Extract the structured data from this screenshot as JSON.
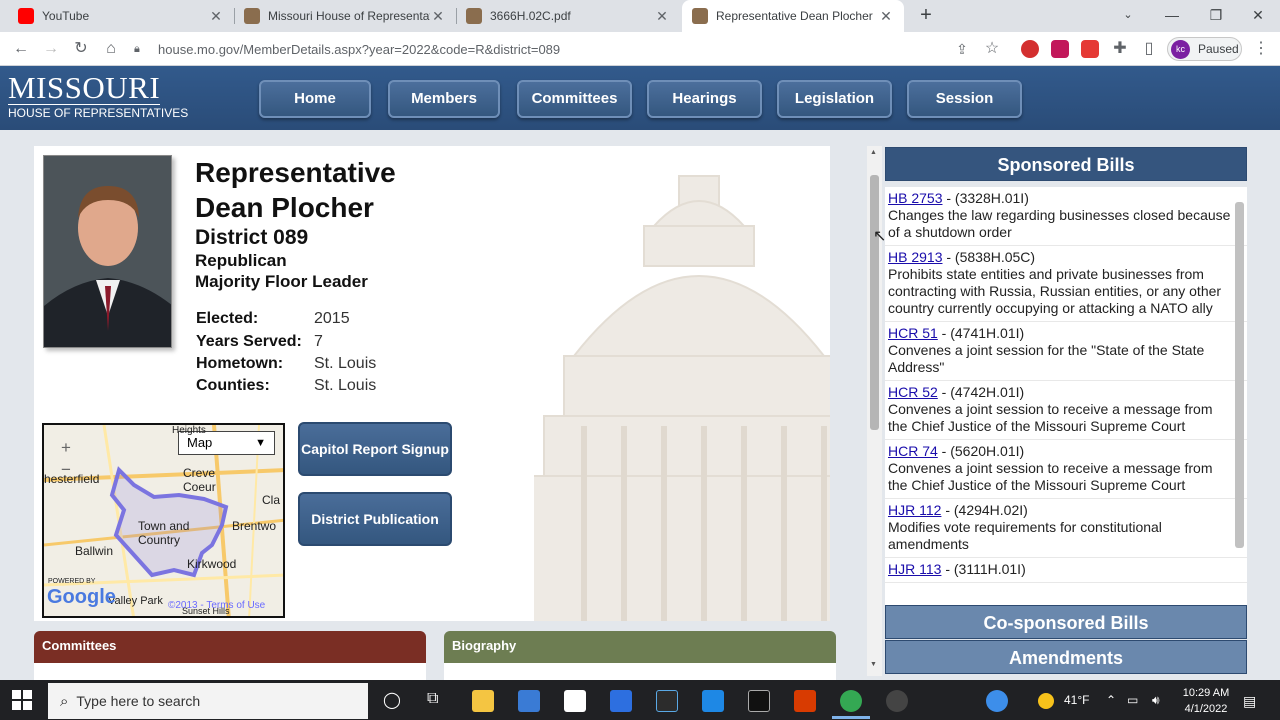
{
  "browser": {
    "tabs": [
      {
        "title": "YouTube",
        "active": false,
        "favicon_color": "#ff0000"
      },
      {
        "title": "Missouri House of Representativ",
        "active": false,
        "favicon_color": "#8a6d4e"
      },
      {
        "title": "3666H.02C.pdf",
        "active": false,
        "favicon_color": "#8a6d4e"
      },
      {
        "title": "Representative Dean Plocher",
        "active": true,
        "favicon_color": "#8a6d4e"
      }
    ],
    "new_tab": "+",
    "url": "house.mo.gov/MemberDetails.aspx?year=2022&code=R&district=089",
    "profile_initials": "kc",
    "profile_status": "Paused"
  },
  "site": {
    "logo_main": "MISSOURI",
    "logo_sub": "HOUSE OF REPRESENTATIVES",
    "nav": [
      "Home",
      "Members",
      "Committees",
      "Hearings",
      "Legislation",
      "Session"
    ]
  },
  "member": {
    "title": "Representative",
    "name": "Dean Plocher",
    "district": "District 089",
    "party": "Republican",
    "role": "Majority Floor Leader",
    "details": [
      {
        "label": "Elected:",
        "value": "2015"
      },
      {
        "label": "Years Served:",
        "value": "7"
      },
      {
        "label": "Hometown:",
        "value": "St. Louis"
      },
      {
        "label": "Counties:",
        "value": "St. Louis"
      }
    ]
  },
  "map": {
    "type_select": "Map",
    "zoom_in": "+",
    "zoom_out": "−",
    "labels": [
      "Heights",
      "Creve Coeur",
      "hesterfield",
      "Cla",
      "Town and Country",
      "Brentwo",
      "Ballwin",
      "Kirkwood",
      "Valley Park",
      "Sunset Hills"
    ],
    "powered_by": "POWERED BY",
    "google": "Google",
    "terms": "©2013 - Terms of Use"
  },
  "buttons": {
    "capitol_report": "Capitol Report Signup",
    "district_publication": "District Publication"
  },
  "sections": {
    "committees": "Committees",
    "biography": "Biography"
  },
  "panel": {
    "sponsored": "Sponsored Bills",
    "cosponsored": "Co-sponsored Bills",
    "amendments": "Amendments",
    "bills": [
      {
        "code": "HB 2753",
        "ref": " - (3328H.01I)",
        "desc": "Changes the law regarding businesses closed because of a shutdown order"
      },
      {
        "code": "HB 2913",
        "ref": " - (5838H.05C)",
        "desc": "Prohibits state entities and private businesses from contracting with Russia, Russian entities, or any other country currently occupying or attacking a NATO ally"
      },
      {
        "code": "HCR 51",
        "ref": " - (4741H.01I)",
        "desc": "Convenes a joint session for the \"State of the State Address\""
      },
      {
        "code": "HCR 52",
        "ref": " - (4742H.01I)",
        "desc": "Convenes a joint session to receive a message from the Chief Justice of the Missouri Supreme Court"
      },
      {
        "code": "HCR 74",
        "ref": " - (5620H.01I)",
        "desc": "Convenes a joint session to receive a message from the Chief Justice of the Missouri Supreme Court"
      },
      {
        "code": "HJR 112",
        "ref": " - (4294H.02I)",
        "desc": "Modifies vote requirements for constitutional amendments"
      },
      {
        "code": "HJR 113",
        "ref": " - (3111H.01I)",
        "desc": ""
      }
    ]
  },
  "taskbar": {
    "search_placeholder": "Type here to search",
    "weather": "41°F",
    "time": "10:29 AM",
    "date": "4/1/2022"
  },
  "colors": {
    "header_blue": "#2e5283",
    "committees_head": "#7a2e24",
    "biography_head": "#6d7d52",
    "link": "#1a0dab"
  }
}
